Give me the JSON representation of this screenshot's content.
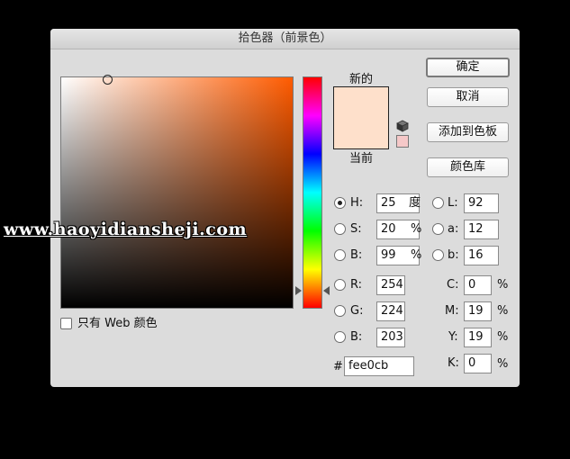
{
  "window": {
    "title": "拾色器（前景色）"
  },
  "watermark": {
    "text": "www.haoyidiansheji.com"
  },
  "picker": {
    "base_hue_color": "#ff5b00",
    "new_label": "新的",
    "current_label": "当前",
    "new_color": "#fee0cb",
    "current_color": "#fee0cb",
    "gamut_warning_color": "#f5c8c8",
    "web_only_label": "只有 Web 颜色",
    "web_only_checked": false
  },
  "buttons": {
    "ok": "确定",
    "cancel": "取消",
    "add_to_swatches": "添加到色板",
    "color_libraries": "颜色库"
  },
  "fields": {
    "H": {
      "label": "H:",
      "value": "25",
      "unit": "度"
    },
    "S": {
      "label": "S:",
      "value": "20",
      "unit": "%"
    },
    "B": {
      "label": "B:",
      "value": "99",
      "unit": "%"
    },
    "R": {
      "label": "R:",
      "value": "254"
    },
    "G": {
      "label": "G:",
      "value": "224"
    },
    "Bl": {
      "label": "B:",
      "value": "203"
    },
    "L": {
      "label": "L:",
      "value": "92"
    },
    "a": {
      "label": "a:",
      "value": "12"
    },
    "b": {
      "label": "b:",
      "value": "16"
    },
    "C": {
      "label": "C:",
      "value": "0",
      "unit": "%"
    },
    "M": {
      "label": "M:",
      "value": "19",
      "unit": "%"
    },
    "Y": {
      "label": "Y:",
      "value": "19",
      "unit": "%"
    },
    "K": {
      "label": "K:",
      "value": "0",
      "unit": "%"
    },
    "hex": {
      "label": "#",
      "value": "fee0cb"
    }
  }
}
